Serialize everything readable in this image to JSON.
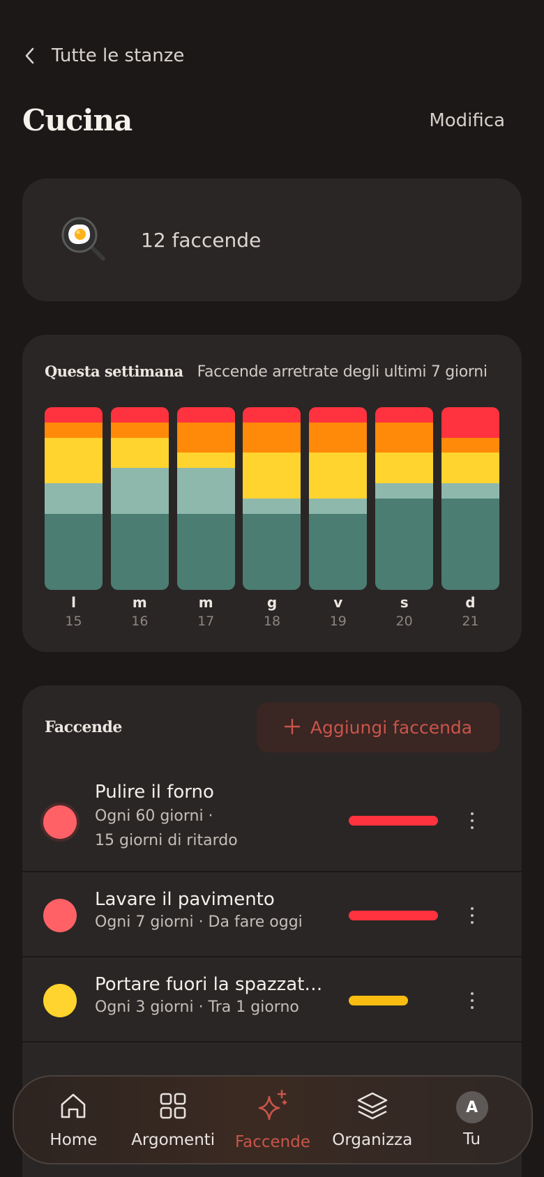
{
  "nav_back": {
    "label": "Tutte le stanze"
  },
  "header": {
    "title": "Cucina",
    "edit_label": "Modifica"
  },
  "room": {
    "icon": "frying-pan-egg-icon",
    "chore_count_label": "12 faccende"
  },
  "week": {
    "title": "Questa settimana",
    "subtitle": "Faccende arretrate degli ultimi 7 giorni",
    "colors": {
      "overdue_red": "#ff333f",
      "orange": "#ff8a0a",
      "yellow": "#ffd42e",
      "light_teal": "#8fb8ad",
      "teal": "#4b7d73"
    },
    "chart_data": {
      "type": "bar",
      "stacked": true,
      "categories": [
        "l",
        "m",
        "m",
        "g",
        "v",
        "s",
        "d"
      ],
      "dates": [
        "15",
        "16",
        "17",
        "18",
        "19",
        "20",
        "21"
      ],
      "series": [
        {
          "color": "#ff333f",
          "values": [
            1,
            1,
            1,
            1,
            1,
            1,
            2
          ]
        },
        {
          "color": "#ff8a0a",
          "values": [
            1,
            1,
            2,
            2,
            2,
            2,
            1
          ]
        },
        {
          "color": "#ffd42e",
          "values": [
            3,
            2,
            1,
            3,
            3,
            2,
            2
          ]
        },
        {
          "color": "#8fb8ad",
          "values": [
            2,
            3,
            3,
            1,
            1,
            1,
            1
          ]
        },
        {
          "color": "#4b7d73",
          "values": [
            5,
            5,
            5,
            5,
            5,
            6,
            6
          ]
        }
      ]
    }
  },
  "chores": {
    "title": "Faccende",
    "add_label": "Aggiungi faccenda",
    "items": [
      {
        "name": "Pulire il forno",
        "meta_line1": "Ogni 60 giorni ·",
        "meta_line2": "15 giorni di ritardo",
        "dot_color": "#ff6166",
        "bar_color": "#ff333f",
        "progress": 1.0
      },
      {
        "name": "Lavare il pavimento",
        "meta_line1": "Ogni 7 giorni · Da fare oggi",
        "meta_line2": "",
        "dot_color": "#ff6166",
        "bar_color": "#ff333f",
        "progress": 1.0
      },
      {
        "name": "Portare fuori la spazzatu…",
        "meta_line1": "Ogni 3 giorni · Tra 1 giorno",
        "meta_line2": "",
        "dot_color": "#ffd42e",
        "bar_color": "#f9bd12",
        "progress": 0.66
      }
    ]
  },
  "tabbar": {
    "items": [
      {
        "label": "Home",
        "icon": "home-icon"
      },
      {
        "label": "Argomenti",
        "icon": "grid-icon"
      },
      {
        "label": "Faccende",
        "icon": "sparkle-icon",
        "active": true
      },
      {
        "label": "Organizza",
        "icon": "layers-icon"
      },
      {
        "label": "Tu",
        "icon": "avatar-icon",
        "avatar_letter": "A"
      }
    ]
  }
}
